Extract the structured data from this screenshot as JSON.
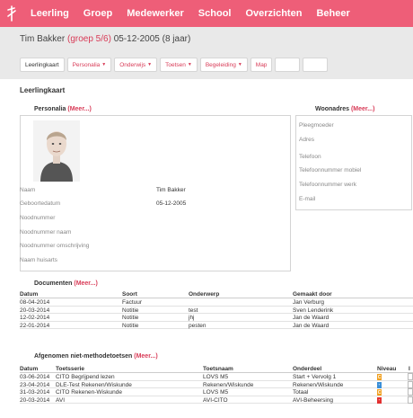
{
  "topnav": {
    "items": [
      "Leerling",
      "Groep",
      "Medewerker",
      "School",
      "Overzichten",
      "Beheer"
    ]
  },
  "student": {
    "name": "Tim Bakker",
    "group": "(groep 5/6)",
    "dob_age": "05-12-2005 (8 jaar)"
  },
  "tabs": [
    {
      "label": "Leerlingkaart",
      "dropdown": false
    },
    {
      "label": "Personalia",
      "dropdown": true
    },
    {
      "label": "Onderwijs",
      "dropdown": true
    },
    {
      "label": "Toetsen",
      "dropdown": true
    },
    {
      "label": "Begeleiding",
      "dropdown": true
    },
    {
      "label": "Map",
      "dropdown": false
    }
  ],
  "page": {
    "heading": "Leerlingkaart"
  },
  "personalia": {
    "title": "Personalia",
    "meer": "(Meer...)",
    "fields": [
      {
        "label": "Naam",
        "value": "Tim Bakker"
      },
      {
        "label": "Geboortedatum",
        "value": "05-12-2005"
      },
      {
        "label": "Noodnummer",
        "value": ""
      },
      {
        "label": "Noodnummer naam",
        "value": ""
      },
      {
        "label": "Noodnummer omschrijving",
        "value": ""
      },
      {
        "label": "Naam huisarts",
        "value": ""
      }
    ]
  },
  "woonadres": {
    "title": "Woonadres",
    "meer": "(Meer...)",
    "fields": [
      "Pleegmoeder",
      "Adres",
      "Telefoon",
      "Telefoonnummer mobiel",
      "Telefoonnummer werk",
      "E-mail"
    ]
  },
  "documenten": {
    "title": "Documenten",
    "meer": "(Meer...)",
    "headers": [
      "Datum",
      "Soort",
      "Onderwerp",
      "Gemaakt door"
    ],
    "rows": [
      [
        "08-04-2014",
        "Factuur",
        "",
        "Jan Verburg"
      ],
      [
        "20-03-2014",
        "Notitie",
        "test",
        "Sven Lenderink"
      ],
      [
        "12-02-2014",
        "Notitie",
        "jhj",
        "Jan de Waard"
      ],
      [
        "22-01-2014",
        "Notitie",
        "pesten",
        "Jan de Waard"
      ]
    ]
  },
  "toetsen": {
    "title": "Afgenomen niet-methodetoetsen",
    "meer": "(Meer...)",
    "headers": [
      "Datum",
      "Toetsserie",
      "Toetsnaam",
      "Onderdeel",
      "Niveau",
      "I"
    ],
    "rows": [
      {
        "cells": [
          "03-06-2014",
          "CITO Begrijpend lezen",
          "LOVS M5",
          "Start + Vervolg 1"
        ],
        "niveau": "C",
        "color": "#f0a020"
      },
      {
        "cells": [
          "23-04-2014",
          "DLE-Test Rekenen/Wiskunde",
          "Rekenen/Wiskunde",
          "Rekenen/Wiskunde"
        ],
        "niveau": "-",
        "color": "#3a8fd8"
      },
      {
        "cells": [
          "31-03-2014",
          "CITO Rekenen-Wiskunde",
          "LOVS M5",
          "Totaal"
        ],
        "niveau": "C",
        "color": "#f0a020"
      },
      {
        "cells": [
          "20-03-2014",
          "AVI",
          "AVI-CITO",
          "AVI-Beheersing"
        ],
        "niveau": "-",
        "color": "#e23030"
      }
    ]
  }
}
